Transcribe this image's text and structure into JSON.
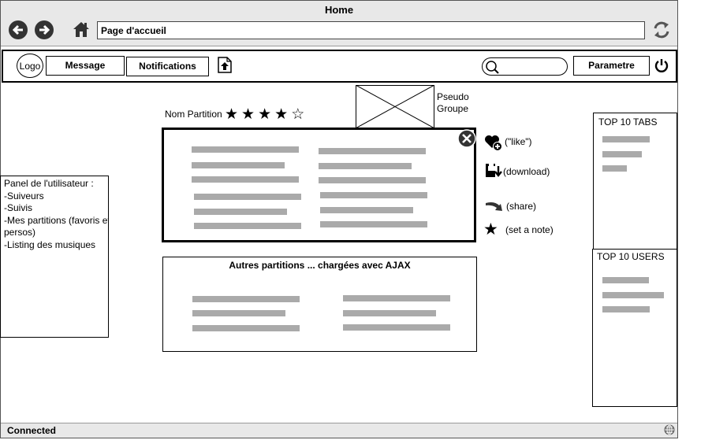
{
  "window": {
    "title": "Home"
  },
  "address_bar": {
    "value": "Page d'accueil"
  },
  "toolbar": {
    "logo": "Logo",
    "message": "Message",
    "notifications": "Notifications",
    "settings": "Parametre"
  },
  "main": {
    "partition_name": "Nom Partition",
    "rating_stars": 4,
    "rating_max": 5,
    "pseudo_line1": "Pseudo",
    "pseudo_line2": "Groupe",
    "actions": {
      "like": "(\"like\")",
      "download": "(download)",
      "share": "(share)",
      "note": "(set a note)"
    },
    "others_title": "Autres partitions ... chargées avec AJAX"
  },
  "user_panel": {
    "title": "Panel de l'utilisateur :",
    "items": [
      "-Suiveurs",
      "-Suivis",
      "-Mes partitions (favoris et",
      "persos)",
      "-Listing des musiques"
    ]
  },
  "top_tabs": {
    "title": "TOP 10 TABS"
  },
  "top_users": {
    "title": "TOP 10 USERS"
  },
  "status": {
    "text": "Connected"
  }
}
